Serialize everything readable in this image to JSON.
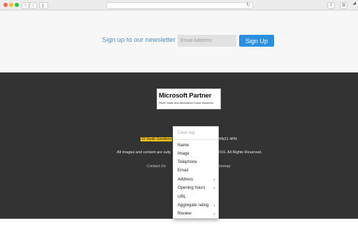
{
  "browser": {
    "back_icon": "‹",
    "forward_icon": "›",
    "reload_icon": "↻",
    "share_icon": "⇧",
    "tabs_icon": "⧉",
    "corner_icon": "◢"
  },
  "newsletter": {
    "label": "Sign up to our newsletter",
    "email_placeholder": "Email Address",
    "button_label": "Sign Up"
  },
  "footer": {
    "badge_title": "Microsoft Partner",
    "badge_subtitle": "Silver Small and Midmarket Cloud Solutions",
    "address_highlight": "15 Hyde Gardens",
    "address_postcode": "BN21 4PR",
    "copyright_left": "All images and content are subj",
    "copyright_right": "016. All Rights Reserved.",
    "contact_link": "Contact Us",
    "sitemap_link": "itemap"
  },
  "context_menu": {
    "items": [
      {
        "label": "Clear tag",
        "disabled": true,
        "submenu": false
      },
      {
        "label": "Name",
        "disabled": false,
        "submenu": false
      },
      {
        "label": "Image",
        "disabled": false,
        "submenu": false
      },
      {
        "label": "Telephone",
        "disabled": false,
        "submenu": false
      },
      {
        "label": "Email",
        "disabled": false,
        "submenu": false
      },
      {
        "label": "Address",
        "disabled": false,
        "submenu": true
      },
      {
        "label": "Opening hours",
        "disabled": false,
        "submenu": true
      },
      {
        "label": "URL",
        "disabled": false,
        "submenu": false
      },
      {
        "label": "Aggregate rating",
        "disabled": false,
        "submenu": true
      },
      {
        "label": "Review",
        "disabled": false,
        "submenu": true
      }
    ],
    "submenu_arrow": "▸"
  },
  "colors": {
    "accent": "#2a8fe0",
    "label_blue": "#4a90c8",
    "footer_bg": "#333333",
    "highlight": "#f5c518"
  }
}
